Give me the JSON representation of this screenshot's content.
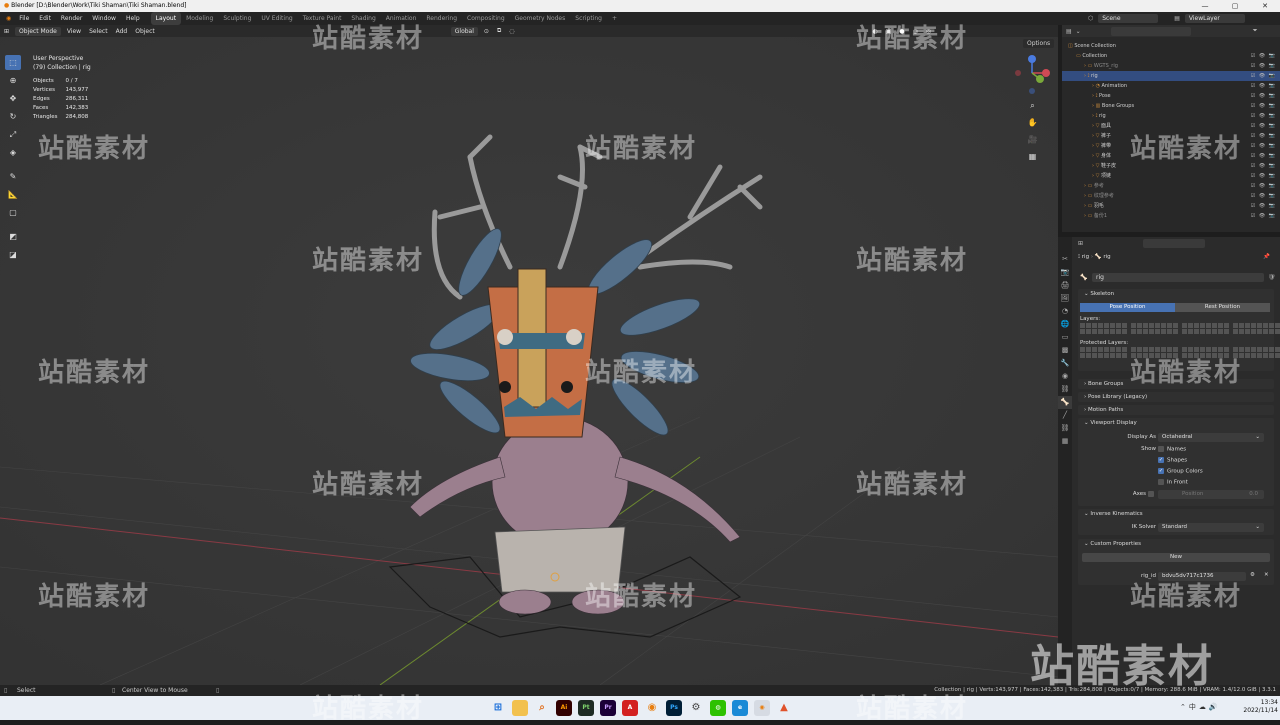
{
  "window": {
    "title": "Blender [D:\\Blender\\Work\\Tiki Shaman\\Tiki Shaman.blend]",
    "controls": [
      "—",
      "▢",
      "✕"
    ]
  },
  "menubar": {
    "menus": [
      "File",
      "Edit",
      "Render",
      "Window",
      "Help"
    ],
    "workspaces": [
      "Layout",
      "Modeling",
      "Sculpting",
      "UV Editing",
      "Texture Paint",
      "Shading",
      "Animation",
      "Rendering",
      "Compositing",
      "Geometry Nodes",
      "Scripting"
    ],
    "add": "+",
    "scene": "Scene",
    "view_layer": "ViewLayer"
  },
  "viewport_header": {
    "mode": "Object Mode",
    "menus": [
      "View",
      "Select",
      "Add",
      "Object"
    ],
    "transform": "Global",
    "options": "Options"
  },
  "overlay": {
    "perspective": "User Perspective",
    "collection": "(79) Collection | rig",
    "stats": [
      {
        "label": "Objects",
        "value": "0 / 7"
      },
      {
        "label": "Vertices",
        "value": "143,977"
      },
      {
        "label": "Edges",
        "value": "286,311"
      },
      {
        "label": "Faces",
        "value": "142,383"
      },
      {
        "label": "Triangles",
        "value": "284,808"
      }
    ]
  },
  "outliner": {
    "search_placeholder": "",
    "rows": [
      {
        "text": "Scene Collection",
        "indent": 0
      },
      {
        "text": "Collection",
        "indent": 1
      },
      {
        "text": "WGTS_rig",
        "indent": 2
      },
      {
        "text": "rig",
        "indent": 2
      },
      {
        "text": "Animation",
        "indent": 3
      },
      {
        "text": "Pose",
        "indent": 3
      },
      {
        "text": "Bone Groups",
        "indent": 3
      },
      {
        "text": "rig",
        "indent": 3
      },
      {
        "text": "面具",
        "indent": 3
      },
      {
        "text": "裤子",
        "indent": 3
      },
      {
        "text": "裤带",
        "indent": 3
      },
      {
        "text": "身体",
        "indent": 3
      },
      {
        "text": "鞋子皮",
        "indent": 3
      },
      {
        "text": "项链",
        "indent": 3
      },
      {
        "text": "参考",
        "indent": 2
      },
      {
        "text": "纹理参考",
        "indent": 2
      },
      {
        "text": "羽毛",
        "indent": 2
      },
      {
        "text": "备份1",
        "indent": 2
      }
    ]
  },
  "properties": {
    "breadcrumb": [
      "rig",
      "rig"
    ],
    "name_field": "rig",
    "skeleton": {
      "title": "Skeleton",
      "pose_position": "Pose Position",
      "rest_position": "Rest Position",
      "layers_label": "Layers:",
      "protected_label": "Protected Layers:"
    },
    "collapsed": [
      "Bone Groups",
      "Pose Library (Legacy)",
      "Motion Paths"
    ],
    "viewport_display": {
      "title": "Viewport Display",
      "display_as_label": "Display As",
      "display_as": "Octahedral",
      "show_label": "Show",
      "names": "Names",
      "shapes": "Shapes",
      "group_colors": "Group Colors",
      "in_front": "In Front",
      "axes_label": "Axes",
      "position_label": "Position",
      "position_value": "0.0"
    },
    "ik": {
      "title": "Inverse Kinematics",
      "solver_label": "IK Solver",
      "solver": "Standard"
    },
    "custom": {
      "title": "Custom Properties",
      "new": "New",
      "key": "rig_id",
      "value": "bdvu5dv717c1736"
    }
  },
  "statusbar": {
    "select": "Select",
    "center": "Center View to Mouse",
    "stats": "Collection | rig | Verts:143,977 | Faces:142,383 | Tris:284,808 | Objects:0/7 | Memory: 288.6 MiB | VRAM: 1.4/12.0 GiB | 3.3.1"
  },
  "taskbar": {
    "time": "13:34",
    "date": "2022/11/14"
  },
  "watermark": "站酷素材",
  "colors": {
    "accent": "#4772b3",
    "viewport": "#393939",
    "panel": "#2b2b2b"
  }
}
